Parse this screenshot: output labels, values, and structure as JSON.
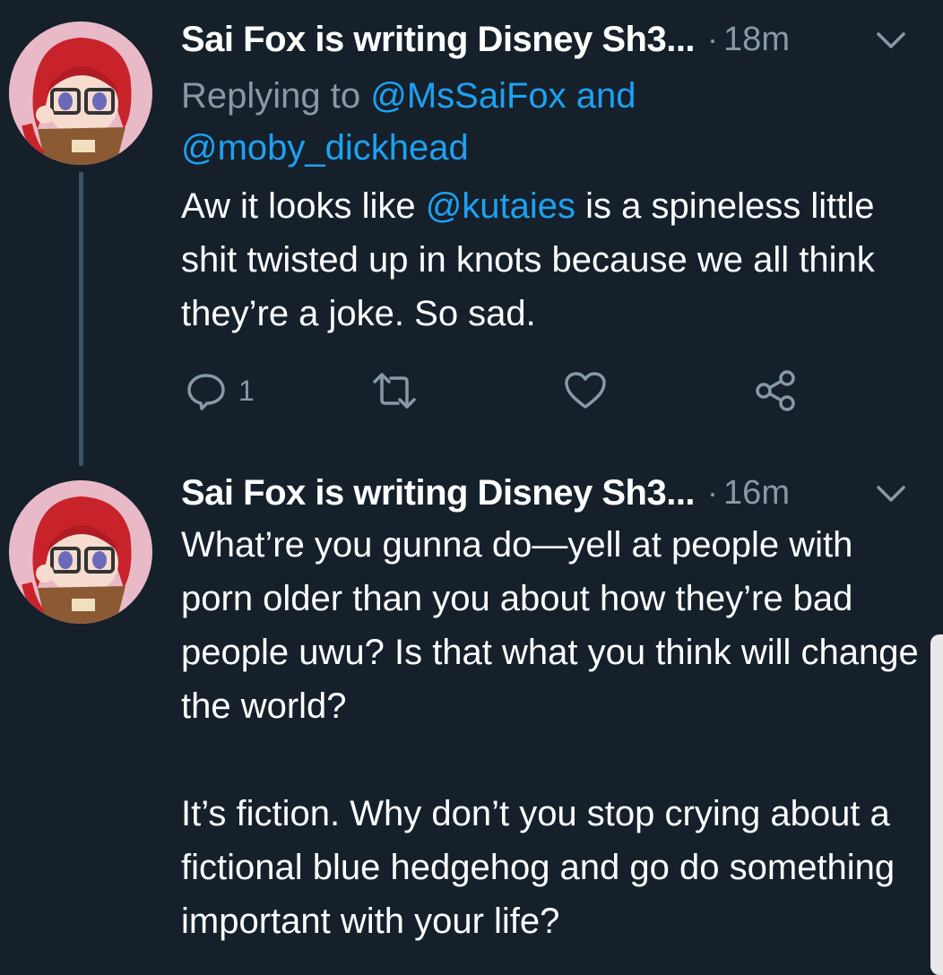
{
  "tweets": [
    {
      "display_name": "Sai Fox is writing Disney Sh3...",
      "separator": "·",
      "time": "18m",
      "replying_prefix": "Replying to ",
      "reply_mention_1": "@MsSaiFox",
      "reply_and": " and",
      "reply_mention_2": "@moby_dickhead",
      "text_before": "Aw it looks like ",
      "text_mention": "@kutaies",
      "text_after": " is a spineless little shit twisted up in knots because we all think they’re a joke. So sad.",
      "reply_count": "1"
    },
    {
      "display_name": "Sai Fox is writing Disney Sh3...",
      "separator": "·",
      "time": "16m",
      "paragraph_1": "What’re you gunna do—yell at people with porn older than you about how they’re bad people uwu? Is that what you think will change the world?",
      "paragraph_2": "It’s fiction. Why don’t you stop crying about a fictional blue hedgehog and go do something important with your life?"
    }
  ],
  "icons": {
    "reply": "reply-icon",
    "retweet": "retweet-icon",
    "like": "heart-icon",
    "share": "share-icon",
    "menu": "chevron-down-icon"
  },
  "colors": {
    "background": "#15202b",
    "secondary_text": "#8899a6",
    "link": "#1da1f2",
    "thread_line": "#3d5466"
  }
}
